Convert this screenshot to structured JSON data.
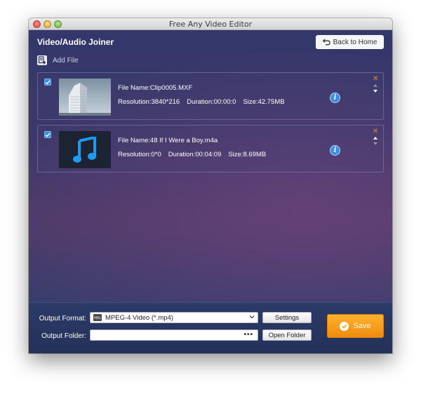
{
  "window": {
    "title": "Free Any Video Editor"
  },
  "header": {
    "title": "Video/Audio Joiner",
    "back_button": "Back to Home"
  },
  "toolbar": {
    "add_file_label": "Add File"
  },
  "files": [
    {
      "checked": true,
      "name": "File Name:Clip0005.MXF",
      "resolution": "Resolution:3840*216",
      "duration": "Duration:00:00:0",
      "size": "Size:42.75MB",
      "thumbnail": "building-photo"
    },
    {
      "checked": true,
      "name": "File Name:48 If I Were a Boy.m4a",
      "resolution": "Resolution:0*0",
      "duration": "Duration:00:04:09",
      "size": "Size:8.69MB",
      "thumbnail": "music-note-icon"
    }
  ],
  "icons": {
    "info": "i",
    "remove": "✕"
  },
  "bottom": {
    "output_format_label": "Output Format:",
    "output_format_value": "MPEG-4 Video (*.mp4)",
    "output_format_icon_text": "MPEG",
    "settings_button": "Settings",
    "output_folder_label": "Output Folder:",
    "output_folder_value": "",
    "folder_dots": "•••",
    "open_folder_button": "Open Folder",
    "save_button": "Save"
  },
  "colors": {
    "accent": "#3a8ee8",
    "save": "#f5a11d",
    "remove": "#f08a24"
  }
}
